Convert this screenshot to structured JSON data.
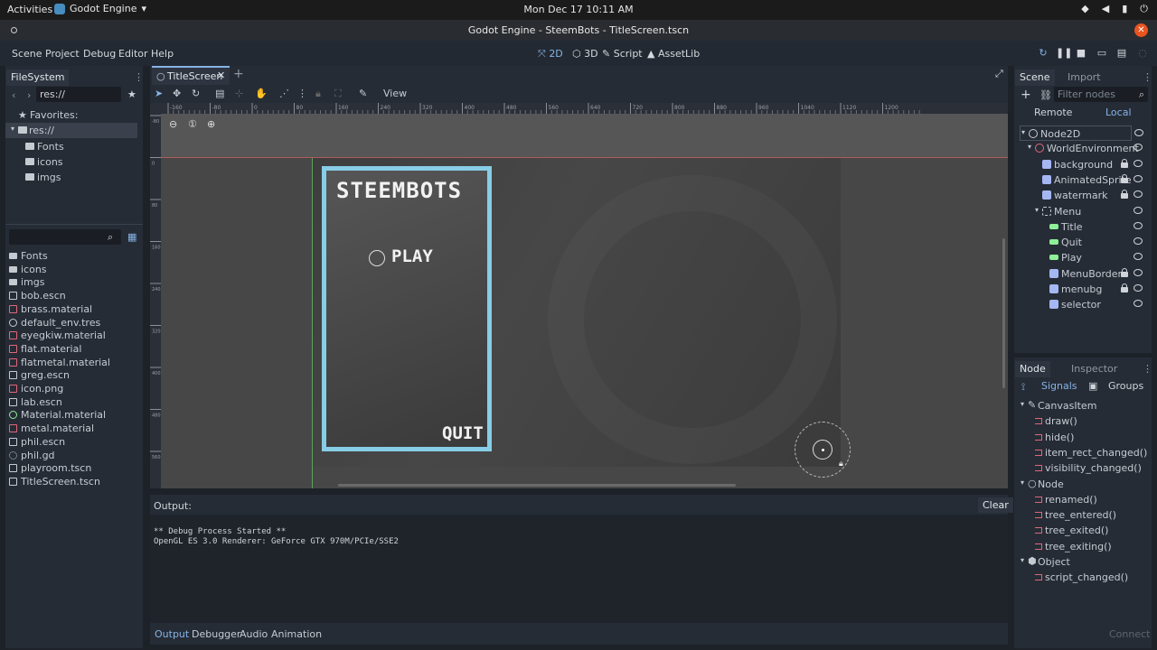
{
  "gnome": {
    "activities": "Activities",
    "app_name": "Godot Engine",
    "clock": "Mon Dec 17  10:11 AM"
  },
  "window": {
    "title": "Godot Engine - SteemBots - TitleScreen.tscn"
  },
  "menus": [
    "Scene",
    "Project",
    "Debug",
    "Editor",
    "Help"
  ],
  "modes": {
    "d2": "2D",
    "d3": "3D",
    "script": "Script",
    "assetlib": "AssetLib"
  },
  "filesystem": {
    "tab": "FileSystem",
    "path": "res://",
    "favorites": "Favorites:",
    "root": "res://",
    "folders": [
      "Fonts",
      "icons",
      "imgs"
    ],
    "files": [
      {
        "name": "Fonts",
        "type": "folder"
      },
      {
        "name": "icons",
        "type": "folder"
      },
      {
        "name": "imgs",
        "type": "folder"
      },
      {
        "name": "bob.escn",
        "type": "scene"
      },
      {
        "name": "brass.material",
        "type": "material"
      },
      {
        "name": "default_env.tres",
        "type": "env"
      },
      {
        "name": "eyegkiw.material",
        "type": "material"
      },
      {
        "name": "flat.material",
        "type": "material"
      },
      {
        "name": "flatmetal.material",
        "type": "material"
      },
      {
        "name": "greg.escn",
        "type": "scene"
      },
      {
        "name": "icon.png",
        "type": "image"
      },
      {
        "name": "lab.escn",
        "type": "scene"
      },
      {
        "name": "Material.material",
        "type": "material2"
      },
      {
        "name": "metal.material",
        "type": "material"
      },
      {
        "name": "phil.escn",
        "type": "scene"
      },
      {
        "name": "phil.gd",
        "type": "script"
      },
      {
        "name": "playroom.tscn",
        "type": "scene"
      },
      {
        "name": "TitleScreen.tscn",
        "type": "scene"
      }
    ]
  },
  "editor": {
    "tab": "TitleScreen",
    "view": "View"
  },
  "game": {
    "title": "STEEMBOTS",
    "play": "PLAY",
    "quit": "QUIT"
  },
  "scene_dock": {
    "tabs": [
      "Scene",
      "Import"
    ],
    "filter_placeholder": "Filter nodes",
    "remote": "Remote",
    "local": "Local",
    "nodes": [
      {
        "name": "Node2D",
        "indent": 0,
        "icon": "#c6cbd2",
        "lock": false
      },
      {
        "name": "WorldEnvironment",
        "indent": 1,
        "icon": "#e0677a",
        "lock": false
      },
      {
        "name": "background",
        "indent": 2,
        "icon": "#a5b7f3",
        "lock": true
      },
      {
        "name": "AnimatedSprite",
        "indent": 2,
        "icon": "#a5b7f3",
        "lock": true
      },
      {
        "name": "watermark",
        "indent": 2,
        "icon": "#a5b7f3",
        "lock": true
      },
      {
        "name": "Menu",
        "indent": 2,
        "icon": "#c6cbd2",
        "lock": false
      },
      {
        "name": "Title",
        "indent": 3,
        "icon": "#8eef97",
        "lock": false
      },
      {
        "name": "Quit",
        "indent": 3,
        "icon": "#8eef97",
        "lock": false
      },
      {
        "name": "Play",
        "indent": 3,
        "icon": "#8eef97",
        "lock": false
      },
      {
        "name": "MenuBorder",
        "indent": 3,
        "icon": "#a5b7f3",
        "lock": true
      },
      {
        "name": "menubg",
        "indent": 3,
        "icon": "#a5b7f3",
        "lock": true
      },
      {
        "name": "selector",
        "indent": 3,
        "icon": "#a5b7f3",
        "lock": false
      }
    ]
  },
  "node_dock": {
    "tabs": [
      "Node",
      "Inspector"
    ],
    "signals": "Signals",
    "groups": "Groups",
    "sections": [
      {
        "header": "CanvasItem",
        "items": [
          "draw()",
          "hide()",
          "item_rect_changed()",
          "visibility_changed()"
        ]
      },
      {
        "header": "Node",
        "items": [
          "renamed()",
          "tree_entered()",
          "tree_exited()",
          "tree_exiting()"
        ]
      },
      {
        "header": "Object",
        "items": [
          "script_changed()"
        ]
      }
    ],
    "connect": "Connect"
  },
  "output": {
    "label": "Output:",
    "clear": "Clear",
    "lines": [
      "** Debug Process Started **",
      "OpenGL ES 3.0 Renderer: GeForce GTX 970M/PCIe/SSE2"
    ],
    "tabs": [
      "Output",
      "Debugger",
      "Audio",
      "Animation"
    ]
  },
  "ruler_labels": [
    "-160",
    "-80",
    "0",
    "80",
    "160",
    "240",
    "320",
    "400",
    "480",
    "560",
    "640",
    "720",
    "800",
    "880",
    "960",
    "1040",
    "1120",
    "1200"
  ],
  "ruler_v_labels": [
    "-80",
    "0",
    "80",
    "160",
    "240",
    "320",
    "400",
    "480",
    "560"
  ]
}
